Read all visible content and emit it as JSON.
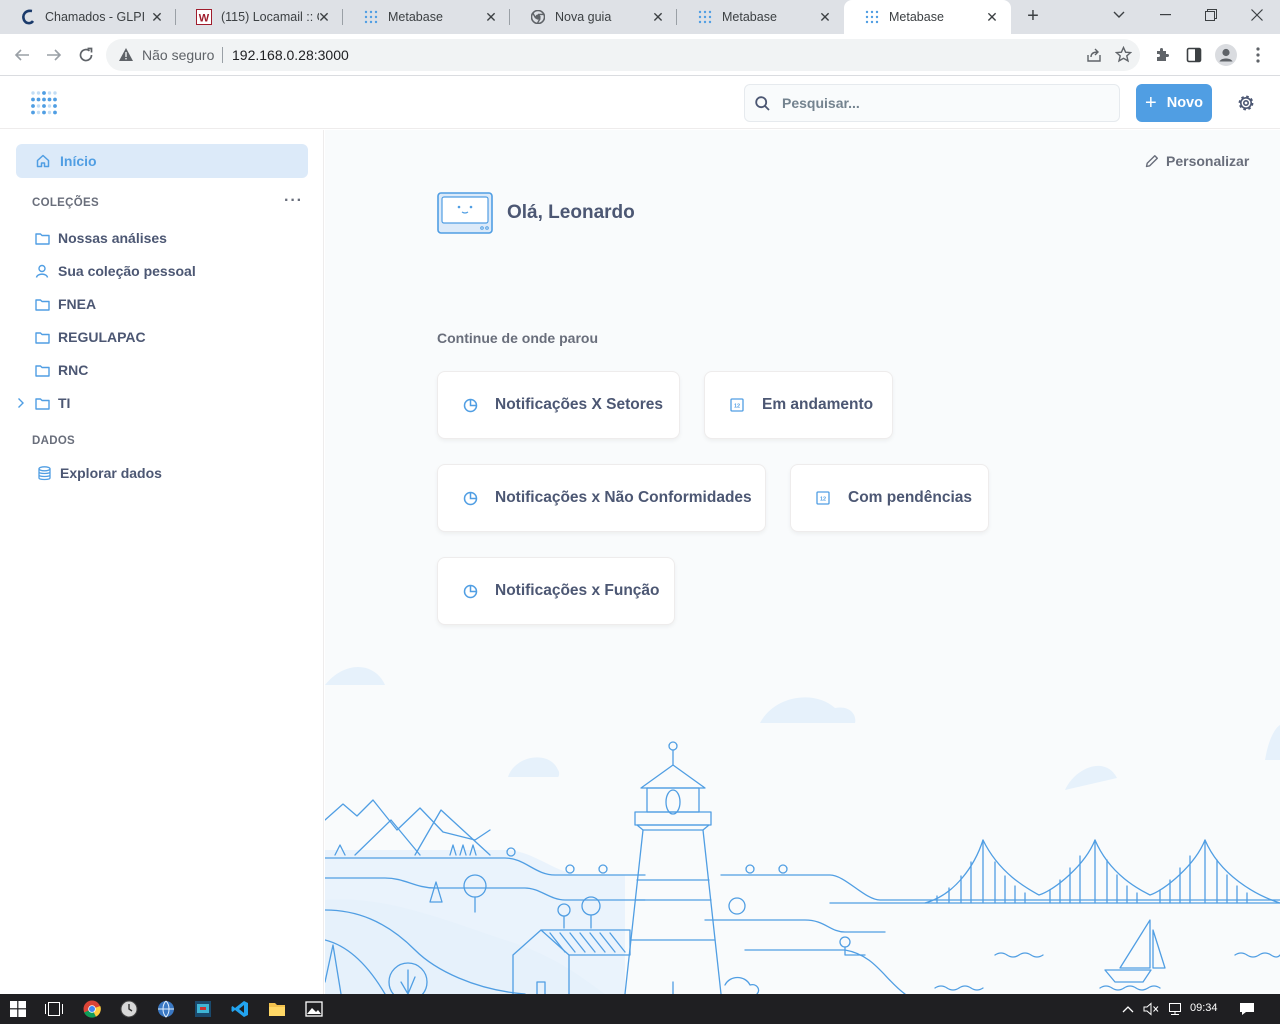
{
  "browser": {
    "tabs": [
      {
        "label": "Chamados - GLPI",
        "icon": "glpi-icon",
        "active": false
      },
      {
        "label": "(115) Locamail :: Ca",
        "icon": "locamail-icon",
        "active": false
      },
      {
        "label": "Metabase",
        "icon": "metabase-icon",
        "active": false
      },
      {
        "label": "Nova guia",
        "icon": "chrome-icon",
        "active": false
      },
      {
        "label": "Metabase",
        "icon": "metabase-icon",
        "active": false
      },
      {
        "label": "Metabase",
        "icon": "metabase-icon",
        "active": true
      }
    ],
    "security_label": "Não seguro",
    "url": "192.168.0.28:3000"
  },
  "header": {
    "search_placeholder": "Pesquisar...",
    "new_button": "Novo"
  },
  "sidebar": {
    "home": "Início",
    "collections_title": "COLEÇÕES",
    "collections": [
      {
        "label": "Nossas análises",
        "icon": "folder-icon"
      },
      {
        "label": "Sua coleção pessoal",
        "icon": "person-icon"
      },
      {
        "label": "FNEA",
        "icon": "folder-icon"
      },
      {
        "label": "REGULAPAC",
        "icon": "folder-icon"
      },
      {
        "label": "RNC",
        "icon": "folder-icon"
      },
      {
        "label": "TI",
        "icon": "folder-icon",
        "expandable": true
      }
    ],
    "data_title": "DADOS",
    "explore": "Explorar dados"
  },
  "main": {
    "customize": "Personalizar",
    "greeting": "Olá, Leonardo",
    "continue_title": "Continue de onde parou",
    "recents": [
      {
        "label": "Notificações X Setores",
        "icon": "pie-chart-icon"
      },
      {
        "label": "Em andamento",
        "icon": "number-card-icon"
      },
      {
        "label": "Notificações x Não Conformidades",
        "icon": "pie-chart-icon"
      },
      {
        "label": "Com pendências",
        "icon": "number-card-icon"
      },
      {
        "label": "Notificações x Função",
        "icon": "pie-chart-icon"
      }
    ]
  },
  "taskbar": {
    "time": "09:34"
  },
  "colors": {
    "brand": "#509ee3",
    "text": "#4c5773",
    "sidebar_active_bg": "#dceaf9"
  }
}
